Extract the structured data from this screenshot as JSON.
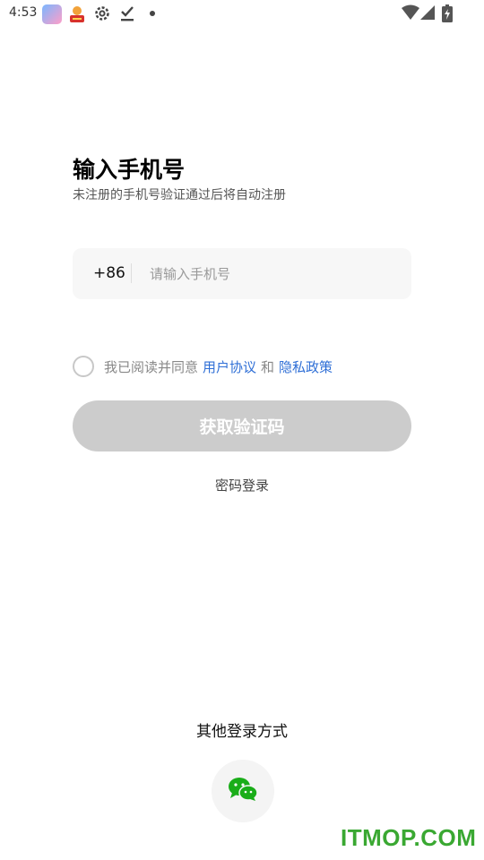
{
  "status_bar": {
    "time": "4:53",
    "icons": [
      "app-icon",
      "app-icon",
      "gear-icon",
      "download-done-icon",
      "notification-dot-icon",
      "wifi-icon",
      "signal-icon",
      "battery-charging-icon"
    ]
  },
  "header": {
    "title": "输入手机号",
    "subtitle": "未注册的手机号验证通过后将自动注册"
  },
  "phone": {
    "country_code": "+86",
    "placeholder": "请输入手机号",
    "value": ""
  },
  "agreement": {
    "prefix": "我已阅读并同意",
    "user_agreement": "用户协议",
    "and": "和",
    "privacy_policy": "隐私政策",
    "link_color": "#2f6fd6",
    "checked": false
  },
  "actions": {
    "get_code_label": "获取验证码",
    "button_color": "#cccccc",
    "password_login": "密码登录"
  },
  "other_login": {
    "title": "其他登录方式",
    "methods": [
      "wechat-icon"
    ],
    "wechat_color": "#1aad19"
  },
  "watermark": "ITMOP.COM"
}
